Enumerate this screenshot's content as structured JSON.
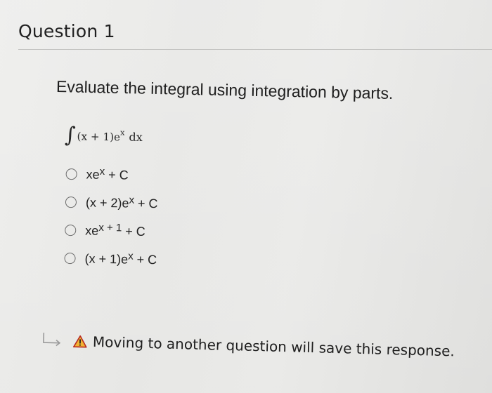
{
  "question": {
    "title": "Question 1",
    "prompt": "Evaluate the integral using integration by parts.",
    "integral": {
      "sign": "∫",
      "expression_base": "(x + 1)e",
      "expression_exp": "x",
      "differential": "dx"
    },
    "options": [
      {
        "base": "xe",
        "exp": "x",
        "tail": " + C"
      },
      {
        "base": "(x + 2)e",
        "exp": "x",
        "tail": " + C"
      },
      {
        "base": "xe",
        "exp": "x + 1",
        "tail": " + C"
      },
      {
        "base": "(x + 1)e",
        "exp": "x",
        "tail": " + C"
      }
    ]
  },
  "footer": {
    "warning_text": "Moving to another question will save this response.",
    "icons": {
      "arrow": "return-arrow-icon",
      "warning": "warning-triangle-icon"
    }
  },
  "colors": {
    "warning_fill": "#f2b233",
    "warning_stroke": "#b7281f",
    "rule": "#c4c4c2"
  }
}
